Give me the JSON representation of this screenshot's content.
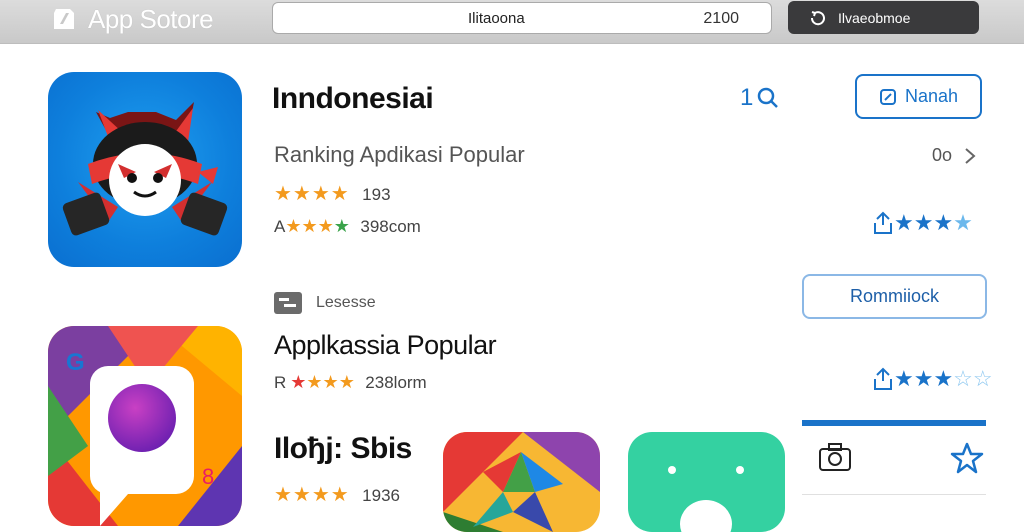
{
  "header": {
    "app_name": "App Sotore",
    "search_text": "Ilitaoona",
    "search_count": "2100",
    "top_button_label": "Ilvaeobmoe"
  },
  "featured": {
    "title": "Inndonesiai",
    "subtitle": "Ranking Apdikasi Popular",
    "rating_count": "193",
    "meta_prefix": "A",
    "meta_text": "398com",
    "search_count": "1",
    "action_button": "Nanah",
    "more_text": "0o"
  },
  "section": {
    "label": "Lesesse",
    "button": "Rommiiock"
  },
  "second": {
    "title": "Applkassia Popular",
    "meta_prefix": "R",
    "meta_text": "238lorm"
  },
  "third": {
    "title": "Iloђj: Sbis",
    "rating_count": "1936"
  },
  "ratings": {
    "featured_stars": 4,
    "featured_right_stars": 4,
    "second_right_stars": 3
  },
  "colors": {
    "accent": "#1a73c9",
    "star": "#f39a1e"
  }
}
